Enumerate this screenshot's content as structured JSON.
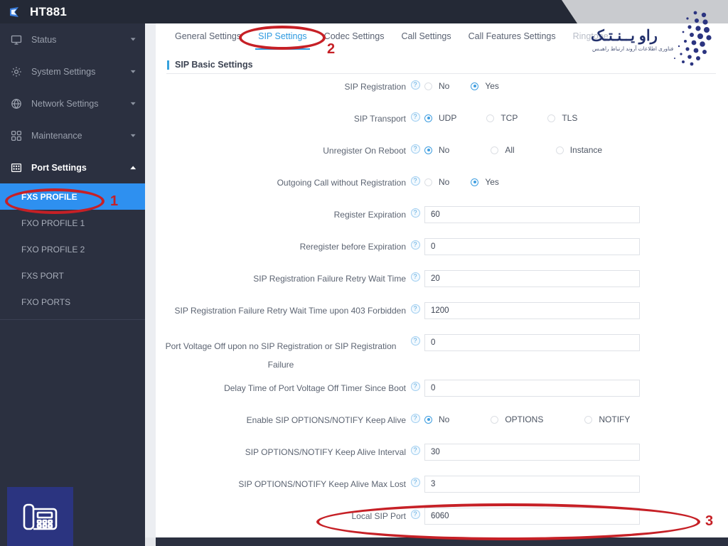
{
  "header": {
    "app_title": "HT881",
    "logo_icon": "grandstream-logo-icon"
  },
  "sidebar": {
    "items": [
      {
        "label": "Status",
        "icon": "monitor-icon",
        "chevron": "chevron-down-icon",
        "expanded": false
      },
      {
        "label": "System Settings",
        "icon": "gear-icon",
        "chevron": "chevron-down-icon",
        "expanded": false
      },
      {
        "label": "Network Settings",
        "icon": "globe-icon",
        "chevron": "chevron-down-icon",
        "expanded": false
      },
      {
        "label": "Maintenance",
        "icon": "grid-icon",
        "chevron": "chevron-down-icon",
        "expanded": false
      },
      {
        "label": "Port Settings",
        "icon": "ports-icon",
        "chevron": "chevron-up-icon",
        "expanded": true
      }
    ],
    "sub_items": [
      {
        "label": "FXS PROFILE",
        "active": true
      },
      {
        "label": "FXO PROFILE 1",
        "active": false
      },
      {
        "label": "FXO PROFILE 2",
        "active": false
      },
      {
        "label": "FXS PORT",
        "active": false
      },
      {
        "label": "FXO PORTS",
        "active": false
      }
    ],
    "bottom_badge_icon": "desk-phone-icon"
  },
  "tabs": [
    {
      "label": "General Settings",
      "active": false,
      "dim": false
    },
    {
      "label": "SIP Settings",
      "active": true,
      "dim": false
    },
    {
      "label": "Codec Settings",
      "active": false,
      "dim": false
    },
    {
      "label": "Call Settings",
      "active": false,
      "dim": false
    },
    {
      "label": "Call Features Settings",
      "active": false,
      "dim": false
    },
    {
      "label": "Ringtone",
      "active": false,
      "dim": true
    }
  ],
  "section": {
    "title": "SIP Basic Settings"
  },
  "fields": [
    {
      "label": "SIP Registration",
      "type": "radio",
      "help": "help-icon",
      "options": [
        {
          "label": "No",
          "selected": false
        },
        {
          "label": "Yes",
          "selected": true
        }
      ],
      "spacing": "w1"
    },
    {
      "label": "SIP Transport",
      "type": "radio",
      "help": "help-icon",
      "options": [
        {
          "label": "UDP",
          "selected": true
        },
        {
          "label": "TCP",
          "selected": false
        },
        {
          "label": "TLS",
          "selected": false
        }
      ],
      "spacing": "w2"
    },
    {
      "label": "Unregister On Reboot",
      "type": "radio",
      "help": "help-icon",
      "options": [
        {
          "label": "No",
          "selected": true
        },
        {
          "label": "All",
          "selected": false
        },
        {
          "label": "Instance",
          "selected": false
        }
      ],
      "spacing": "w3"
    },
    {
      "label": "Outgoing Call without Registration",
      "type": "radio",
      "help": "help-icon",
      "options": [
        {
          "label": "No",
          "selected": false
        },
        {
          "label": "Yes",
          "selected": true
        }
      ],
      "spacing": "w1"
    },
    {
      "label": "Register Expiration",
      "type": "text",
      "help": "help-icon",
      "value": "60"
    },
    {
      "label": "Reregister before Expiration",
      "type": "text",
      "help": "help-icon",
      "value": "0"
    },
    {
      "label": "SIP Registration Failure Retry Wait Time",
      "type": "text",
      "help": "help-icon",
      "value": "20"
    },
    {
      "label": "SIP Registration Failure Retry Wait Time upon 403 Forbidden",
      "type": "text",
      "help": "help-icon",
      "value": "1200"
    },
    {
      "label": "Port Voltage Off upon no SIP Registration or SIP Registration Failure",
      "type": "text",
      "help": "help-icon",
      "value": "0"
    },
    {
      "label": "Delay Time of Port Voltage Off Timer Since Boot",
      "type": "text",
      "help": "help-icon",
      "value": "0"
    },
    {
      "label": "Enable SIP OPTIONS/NOTIFY Keep Alive",
      "type": "radio",
      "help": "help-icon",
      "options": [
        {
          "label": "No",
          "selected": true
        },
        {
          "label": "OPTIONS",
          "selected": false
        },
        {
          "label": "NOTIFY",
          "selected": false
        }
      ],
      "spacing": "w3"
    },
    {
      "label": "SIP OPTIONS/NOTIFY Keep Alive Interval",
      "type": "text",
      "help": "help-icon",
      "value": "30"
    },
    {
      "label": "SIP OPTIONS/NOTIFY Keep Alive Max Lost",
      "type": "text",
      "help": "help-icon",
      "value": "3"
    },
    {
      "label": "Local SIP Port",
      "type": "text",
      "help": "help-icon",
      "value": "6060"
    }
  ],
  "watermark": {
    "text": "راو یــنـتـک",
    "subtext": "فناوری اطلاعات آروند ارتباط راهبـس"
  },
  "annotations": [
    {
      "number": "1",
      "target": "FXS PROFILE"
    },
    {
      "number": "2",
      "target": "SIP Settings"
    },
    {
      "number": "3",
      "target": "Local SIP Port"
    }
  ],
  "colors": {
    "accent_blue": "#2e9ae0",
    "active_nav": "#2e90f0",
    "sidebar_bg": "#2b3040",
    "header_bg": "#242936",
    "annotation_red": "#c62026",
    "watermark_navy": "#22306c"
  }
}
